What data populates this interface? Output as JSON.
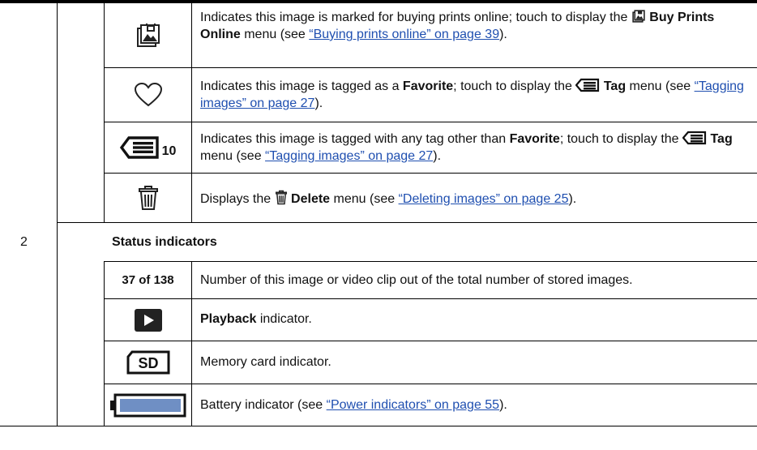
{
  "rows": {
    "buy_prints": {
      "t1": "Indicates this image is marked for buying prints online; touch to display the ",
      "bold": "Buy Prints Online",
      "t2": " menu (see ",
      "link": "“Buying prints online” on page 39",
      "t3": ")."
    },
    "favorite": {
      "t1": "Indicates this image is tagged as a ",
      "bold1": "Favorite",
      "t2": "; touch to display the ",
      "bold2": "Tag",
      "t3": " menu (see ",
      "link": "“Tagging images” on page 27",
      "t4": ")."
    },
    "tag_other": {
      "icon_number": "10",
      "t1": "Indicates this image is tagged with any tag other than ",
      "bold1": "Favorite",
      "t2": "; touch to display the ",
      "bold2": "Tag",
      "t3": " menu (see ",
      "link": "“Tagging images” on page 27",
      "t4": ")."
    },
    "delete": {
      "t1": "Displays the ",
      "bold": "Delete",
      "t2": " menu (see ",
      "link": "“Deleting images” on page 25",
      "t3": ")."
    }
  },
  "section": {
    "number": "2",
    "title": "Status indicators"
  },
  "status": {
    "count": {
      "label": "37 of 138",
      "text": "Number of this image or video clip out of the total number of stored images."
    },
    "playback": {
      "bold": "Playback",
      "t1": " indicator."
    },
    "memory": {
      "text": "Memory card indicator."
    },
    "battery": {
      "t1": "Battery indicator (see ",
      "link": "“Power indicators” on page 55",
      "t2": ")."
    }
  },
  "colors": {
    "link": "#1f4fb0",
    "battery_fill": "#6f8fc4",
    "icon": "#222222"
  }
}
